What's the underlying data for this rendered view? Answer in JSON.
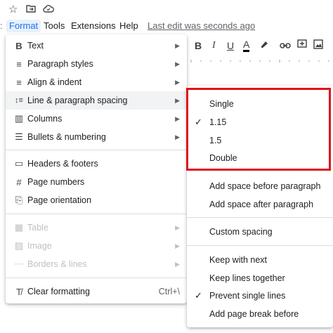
{
  "top_icons": [
    {
      "name": "star-icon",
      "glyph": "☆"
    },
    {
      "name": "move-folder-icon",
      "glyph": "⇲"
    },
    {
      "name": "cloud-icon",
      "glyph": "☁"
    }
  ],
  "menubar": {
    "items": [
      "Format",
      "Tools",
      "Extensions",
      "Help"
    ],
    "last_edit": "Last edit was seconds ago"
  },
  "toolbar": {
    "bold": "B",
    "italic": "I",
    "underline": "U",
    "text_color": "A",
    "highlight_icon": "highlight-icon",
    "link_icon": "link-icon",
    "comment_icon": "add-comment-icon",
    "image_icon": "insert-image-icon"
  },
  "format_menu": {
    "items": [
      {
        "label": "Text",
        "icon": "bold-icon",
        "glyph": "B",
        "arrow": "▶"
      },
      {
        "label": "Paragraph styles",
        "icon": "paragraph-styles-icon",
        "glyph": "≡",
        "arrow": "▶"
      },
      {
        "label": "Align & indent",
        "icon": "align-icon",
        "glyph": "≡",
        "arrow": "▶"
      },
      {
        "label": "Line & paragraph spacing",
        "icon": "line-spacing-icon",
        "glyph": "↕≡",
        "arrow": "▶"
      },
      {
        "label": "Columns",
        "icon": "columns-icon",
        "glyph": "▥",
        "arrow": "▶"
      },
      {
        "label": "Bullets & numbering",
        "icon": "bullets-icon",
        "glyph": "☰",
        "arrow": "▶"
      },
      {
        "label": "Headers & footers",
        "icon": "headers-footers-icon",
        "glyph": "▭"
      },
      {
        "label": "Page numbers",
        "icon": "hash-icon",
        "glyph": "#"
      },
      {
        "label": "Page orientation",
        "icon": "page-orientation-icon",
        "glyph": "⎘"
      },
      {
        "label": "Table",
        "icon": "table-icon",
        "glyph": "▦",
        "arrow": "▶"
      },
      {
        "label": "Image",
        "icon": "image-icon",
        "glyph": "▨",
        "arrow": "▶"
      },
      {
        "label": "Borders & lines",
        "icon": "borders-icon",
        "glyph": "⋯",
        "arrow": "▶"
      },
      {
        "label": "Clear formatting",
        "icon": "clear-formatting-icon",
        "glyph": "T̸",
        "shortcut": "Ctrl+\\"
      }
    ]
  },
  "spacing_submenu": {
    "items": [
      {
        "label": "Single",
        "checked": ""
      },
      {
        "label": "1.15",
        "checked": "✓"
      },
      {
        "label": "1.5",
        "checked": ""
      },
      {
        "label": "Double",
        "checked": ""
      },
      {
        "label": "Add space before paragraph",
        "checked": ""
      },
      {
        "label": "Add space after paragraph",
        "checked": ""
      },
      {
        "label": "Custom spacing",
        "checked": ""
      },
      {
        "label": "Keep with next",
        "checked": ""
      },
      {
        "label": "Keep lines together",
        "checked": ""
      },
      {
        "label": "Prevent single lines",
        "checked": "✓"
      },
      {
        "label": "Add page break before",
        "checked": ""
      }
    ]
  },
  "highlight_color": "#e0131a"
}
